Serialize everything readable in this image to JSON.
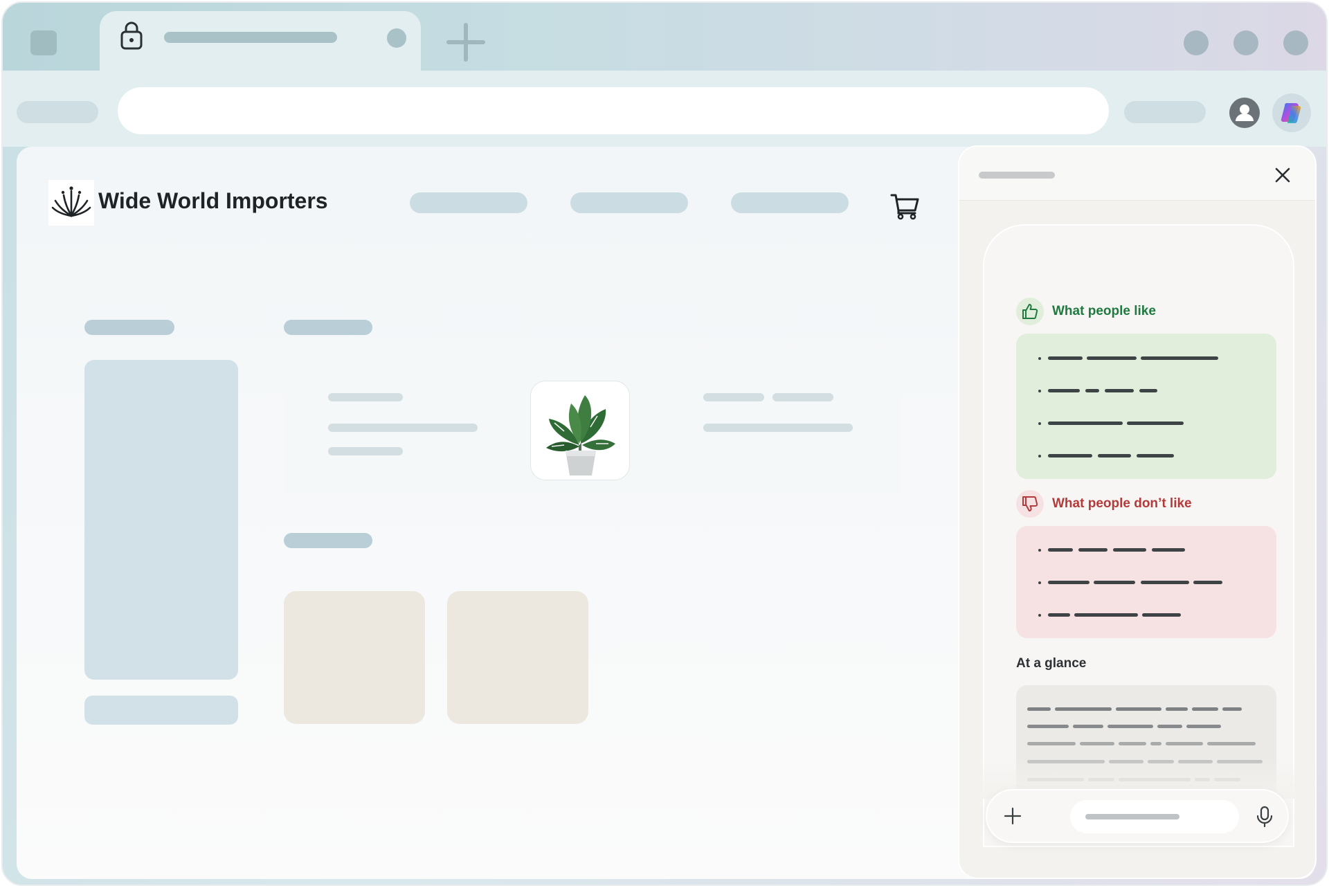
{
  "browser": {
    "active_tab": {
      "lock_icon": "lock-icon"
    },
    "window_controls": [
      "minimize",
      "maximize",
      "close"
    ]
  },
  "site": {
    "brand_name": "Wide World Importers",
    "logo_icon": "lotus-logo-icon",
    "cart_icon": "cart-icon"
  },
  "copilot_panel": {
    "likes_title": "What people like",
    "likes_icon": "thumbs-up-icon",
    "dislikes_title": "What people don’t like",
    "dislikes_icon": "thumbs-down-icon",
    "glance_title": "At a glance",
    "composer": {
      "add_icon": "plus-icon",
      "mic_icon": "microphone-icon"
    }
  },
  "colors": {
    "likes_accent": "#1f7a3f",
    "dislikes_accent": "#b33a3a",
    "likes_bg": "#e1eedb",
    "dislikes_bg": "#f6e2e2"
  }
}
